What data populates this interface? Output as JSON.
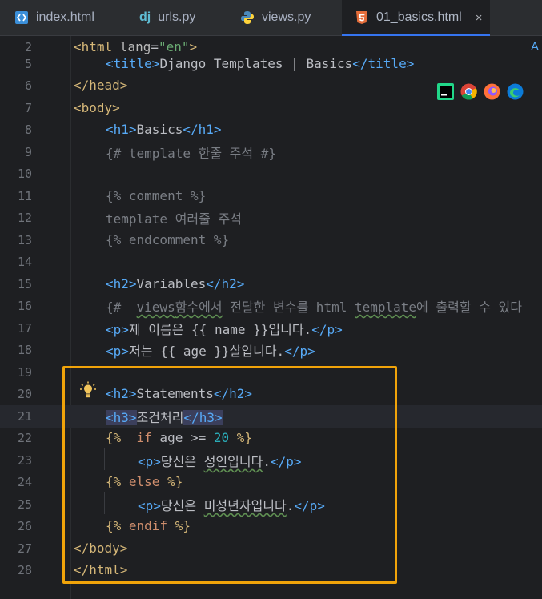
{
  "tabs": [
    {
      "label": "index.html",
      "icon": "html-file-icon"
    },
    {
      "label": "urls.py",
      "icon": "django-icon",
      "icon_text": "dj"
    },
    {
      "label": "views.py",
      "icon": "python-icon"
    },
    {
      "label": "01_basics.html",
      "icon": "html5-icon",
      "active": true
    }
  ],
  "close_glyph": "×",
  "ai_glyph": "A",
  "lines": {
    "l2": "2",
    "l5": "5",
    "l6": "6",
    "l7": "7",
    "l8": "8",
    "l9": "9",
    "l10": "10",
    "l11": "11",
    "l12": "12",
    "l13": "13",
    "l14": "14",
    "l15": "15",
    "l16": "16",
    "l17": "17",
    "l18": "18",
    "l19": "19",
    "l20": "20",
    "l21": "21",
    "l22": "22",
    "l23": "23",
    "l24": "24",
    "l25": "25",
    "l26": "26",
    "l27": "27",
    "l28": "28"
  },
  "code": {
    "c2_a": "<html",
    "c2_b": " lang",
    "c2_c": "=",
    "c2_d": "\"en\"",
    "c2_e": ">",
    "c5_a": "<title>",
    "c5_b": "Django Templates | Basics",
    "c5_c": "</title>",
    "c6": "</head>",
    "c7": "<body>",
    "c8_a": "<h1>",
    "c8_b": "Basics",
    "c8_c": "</h1>",
    "c9": "{# template 한줄 주석 #}",
    "c11": "{% comment %}",
    "c12": "template 여러줄 주석",
    "c13": "{% endcomment %}",
    "c15_a": "<h2>",
    "c15_b": "Variables",
    "c15_c": "</h2>",
    "c16_a": "{#  ",
    "c16_b": "views",
    "c16_c": "함수에서",
    "c16_d": " 전달한 변수를 html ",
    "c16_e": "template",
    "c16_f": "에 출력할 수 있다",
    "c17_a": "<p>",
    "c17_b": "제 이름은 {{ name }}입니다.",
    "c17_c": "</p>",
    "c18_a": "<p>",
    "c18_b": "저는 {{ age }}살입니다.",
    "c18_c": "</p>",
    "c20_a": "<h2>",
    "c20_b": "Statements",
    "c20_c": "</h2>",
    "c21_a": "<h3>",
    "c21_b": "조건처리",
    "c21_c": "</h3>",
    "c22_a": "{%  ",
    "c22_b": "if",
    "c22_c": " age >= ",
    "c22_d": "20",
    "c22_e": " %}",
    "c23_a": "<p>",
    "c23_b": "당신은 ",
    "c23_c": "성인입니다",
    "c23_d": ".",
    "c23_e": "</p>",
    "c24_a": "{% ",
    "c24_b": "else",
    "c24_c": " %}",
    "c25_a": "<p>",
    "c25_b": "당신은 ",
    "c25_c": "미성년자입니다",
    "c25_d": ".",
    "c25_e": "</p>",
    "c26_a": "{% ",
    "c26_b": "endif",
    "c26_c": " %}",
    "c27": "</body>",
    "c28": "</html>"
  },
  "browser_icons": [
    "pycharm-icon",
    "chrome-icon",
    "firefox-icon",
    "edge-icon"
  ],
  "colors": {
    "highlight_box": "#f0a30a",
    "accent": "#3574f0"
  }
}
